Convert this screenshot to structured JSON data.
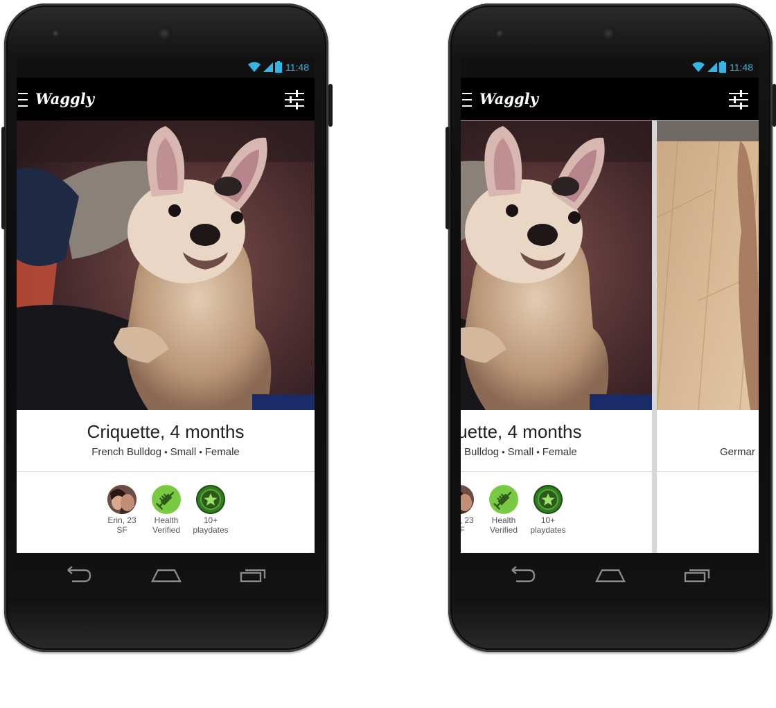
{
  "status": {
    "time": "11:48"
  },
  "app": {
    "title": "Waggly"
  },
  "dog": {
    "name": "Criquette, 4 months",
    "breed": "French Bulldog",
    "size": "Small",
    "sex": "Female",
    "separator": "•"
  },
  "badges": {
    "owner": {
      "line1": "Erin, 23",
      "line2": "SF"
    },
    "health": {
      "line1": "Health",
      "line2": "Verified"
    },
    "playdates": {
      "line1": "10+",
      "line2": "playdates"
    }
  },
  "next_card": {
    "breed_partial": "Germar"
  },
  "colors": {
    "status_blue": "#33b5e5",
    "badge_green": "#7ac943",
    "badge_dark_green": "#2e7d1f",
    "accent_line": "#8bc34a"
  },
  "icons": [
    "menu-icon",
    "filter-icon",
    "wifi-icon",
    "signal-icon",
    "battery-icon",
    "syringe-icon",
    "star-icon",
    "back-icon",
    "home-icon",
    "recents-icon"
  ]
}
